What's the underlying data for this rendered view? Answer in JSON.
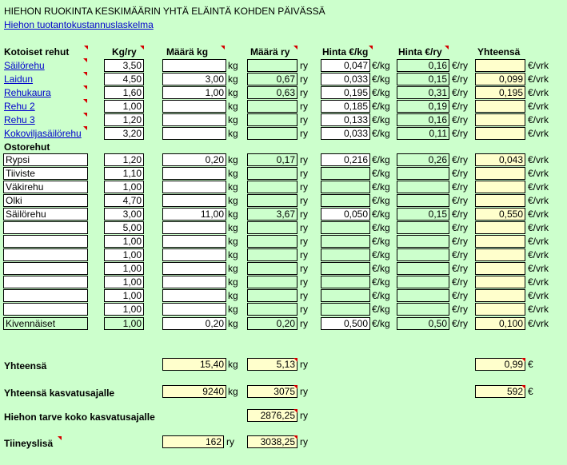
{
  "title": "HIEHON RUOKINTA KESKIMÄÄRIN YHTÄ ELÄINTÄ KOHDEN PÄIVÄSSÄ",
  "sublink": "Hiehon tuotantokustannuslaskelma",
  "headers": {
    "kotoiset": "Kotoiset rehut",
    "kgry": "Kg/ry",
    "maarakg": "Määrä kg",
    "maarary": "Määrä ry",
    "hintakg": "Hinta €/kg",
    "hintary": "Hinta €/ry",
    "yhteensa": "Yhteensä"
  },
  "units": {
    "kg": "kg",
    "ry": "ry",
    "ekg": "€/kg",
    "ery": "€/ry",
    "evrk": "€/vrk",
    "eur": "€"
  },
  "ostorehut": "Ostorehut",
  "rows": [
    {
      "label": "Säilörehu",
      "link": true,
      "kgry": "3,50",
      "maarakg": "",
      "maarary": "",
      "hintakg": "0,047",
      "hintary": "0,16",
      "yht": ""
    },
    {
      "label": "Laidun",
      "link": true,
      "kgry": "4,50",
      "maarakg": "3,00",
      "maarary": "0,67",
      "hintakg": "0,033",
      "hintary": "0,15",
      "yht": "0,099"
    },
    {
      "label": "Rehukaura",
      "link": true,
      "kgry": "1,60",
      "maarakg": "1,00",
      "maarary": "0,63",
      "hintakg": "0,195",
      "hintary": "0,31",
      "yht": "0,195"
    },
    {
      "label": "Rehu 2",
      "link": true,
      "kgry": "1,00",
      "maarakg": "",
      "maarary": "",
      "hintakg": "0,185",
      "hintary": "0,19",
      "yht": ""
    },
    {
      "label": "Rehu 3",
      "link": true,
      "kgry": "1,20",
      "maarakg": "",
      "maarary": "",
      "hintakg": "0,133",
      "hintary": "0,16",
      "yht": ""
    },
    {
      "label": "Kokoviljasäilörehu",
      "link": true,
      "kgry": "3,20",
      "maarakg": "",
      "maarary": "",
      "hintakg": "0,033",
      "hintary": "0,11",
      "yht": ""
    },
    {
      "label": "Rypsi",
      "link": false,
      "kgry": "1,20",
      "maarakg": "0,20",
      "maarary": "0,17",
      "hintakg": "0,216",
      "hintary": "0,26",
      "yht": "0,043"
    },
    {
      "label": "Tiiviste",
      "link": false,
      "kgry": "1,10",
      "maarakg": "",
      "maarary": "",
      "hintakg": "",
      "hintary": "",
      "yht": ""
    },
    {
      "label": "Väkirehu",
      "link": false,
      "kgry": "1,00",
      "maarakg": "",
      "maarary": "",
      "hintakg": "",
      "hintary": "",
      "yht": ""
    },
    {
      "label": "Olki",
      "link": false,
      "kgry": "4,70",
      "maarakg": "",
      "maarary": "",
      "hintakg": "",
      "hintary": "",
      "yht": ""
    },
    {
      "label": "Säilörehu",
      "link": false,
      "kgry": "3,00",
      "maarakg": "11,00",
      "maarary": "3,67",
      "hintakg": "0,050",
      "hintary": "0,15",
      "yht": "0,550"
    },
    {
      "label": "",
      "link": false,
      "kgry": "5,00",
      "maarakg": "",
      "maarary": "",
      "hintakg": "",
      "hintary": "",
      "yht": ""
    },
    {
      "label": "",
      "link": false,
      "kgry": "1,00",
      "maarakg": "",
      "maarary": "",
      "hintakg": "",
      "hintary": "",
      "yht": ""
    },
    {
      "label": "",
      "link": false,
      "kgry": "1,00",
      "maarakg": "",
      "maarary": "",
      "hintakg": "",
      "hintary": "",
      "yht": ""
    },
    {
      "label": "",
      "link": false,
      "kgry": "1,00",
      "maarakg": "",
      "maarary": "",
      "hintakg": "",
      "hintary": "",
      "yht": ""
    },
    {
      "label": "",
      "link": false,
      "kgry": "1,00",
      "maarakg": "",
      "maarary": "",
      "hintakg": "",
      "hintary": "",
      "yht": ""
    },
    {
      "label": "",
      "link": false,
      "kgry": "1,00",
      "maarakg": "",
      "maarary": "",
      "hintakg": "",
      "hintary": "",
      "yht": ""
    },
    {
      "label": "",
      "link": false,
      "kgry": "1,00",
      "maarakg": "",
      "maarary": "",
      "hintakg": "",
      "hintary": "",
      "yht": ""
    },
    {
      "label": "Kivennäiset",
      "link": false,
      "kgry": "1,00",
      "maarakg": "0,20",
      "maarary": "0,20",
      "hintakg": "0,500",
      "hintary": "0,50",
      "yht": "0,100"
    }
  ],
  "totals": {
    "yhteensa_label": "Yhteensä",
    "yhteensa_kg": "15,40",
    "yhteensa_ry": "5,13",
    "yhteensa_eur": "0,99",
    "kasvatus_label": "Yhteensä kasvatusajalle",
    "kasvatus_kg": "9240",
    "kasvatus_ry": "3075",
    "kasvatus_eur": "592",
    "tarve_label": "Hiehon tarve koko kasvatusajalle",
    "tarve_ry": "2876,25",
    "tiineys_label": "Tiineyslisä",
    "tiineys_ry_left": "162",
    "tiineys_ry": "3038,25"
  }
}
